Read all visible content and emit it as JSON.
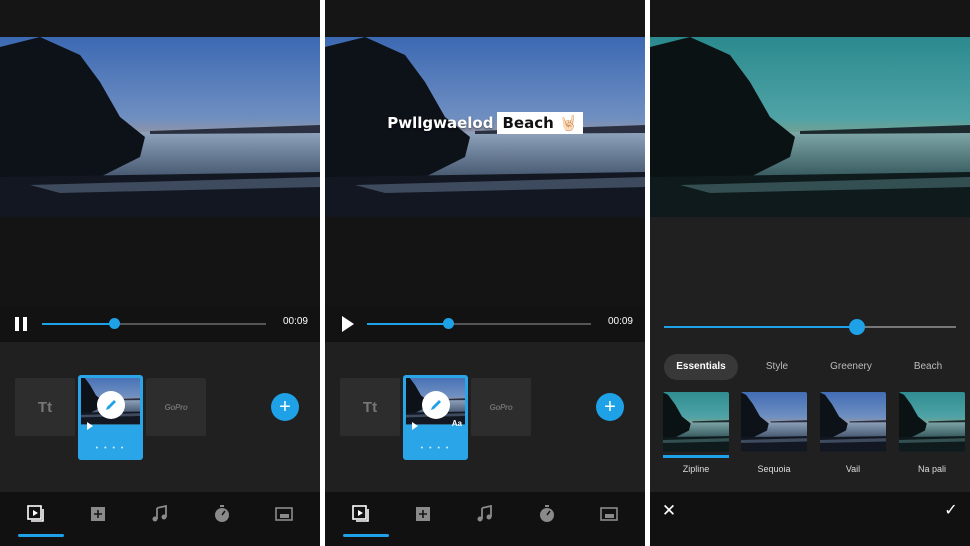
{
  "screens": [
    {
      "id": "trim",
      "playback": {
        "state": "playing",
        "icon": "pause-icon",
        "progress": 0.32,
        "time": "00:09"
      },
      "timeline": {
        "title_tile_label": "Tt",
        "logo_tile_label": "GoPro",
        "selected_clip_dots": "• • • •",
        "add_icon": "plus-icon"
      },
      "nav": {
        "active_tab": 0,
        "tabs": [
          "media-icon",
          "add-clip-icon",
          "music-icon",
          "speed-icon",
          "format-icon"
        ]
      }
    },
    {
      "id": "text",
      "overlay": {
        "word1": "Pwllgwaelod",
        "word2": "Beach",
        "emoji": "🤘🏻"
      },
      "playback": {
        "state": "paused",
        "icon": "play-icon",
        "progress": 0.36,
        "time": "00:09"
      },
      "timeline": {
        "title_tile_label": "Tt",
        "logo_tile_label": "GoPro",
        "selected_clip_badge": "Aa",
        "selected_clip_dots": "• • • •",
        "add_icon": "plus-icon"
      },
      "nav": {
        "active_tab": 0,
        "tabs": [
          "media-icon",
          "add-clip-icon",
          "music-icon",
          "speed-icon",
          "format-icon"
        ]
      }
    },
    {
      "id": "filters",
      "intensity": 0.66,
      "categories": [
        {
          "label": "Essentials",
          "active": true
        },
        {
          "label": "Style",
          "active": false
        },
        {
          "label": "Greenery",
          "active": false
        },
        {
          "label": "Beach",
          "active": false
        }
      ],
      "filters": [
        {
          "name": "Zipline",
          "selected": true
        },
        {
          "name": "Sequoia",
          "selected": false
        },
        {
          "name": "Vail",
          "selected": false
        },
        {
          "name": "Na pali",
          "selected": false
        }
      ],
      "actions": {
        "close": "✕",
        "confirm": "✓"
      }
    }
  ],
  "colors": {
    "accent": "#1ea1e6",
    "background": "#151515",
    "timeline_bg": "#202020"
  }
}
